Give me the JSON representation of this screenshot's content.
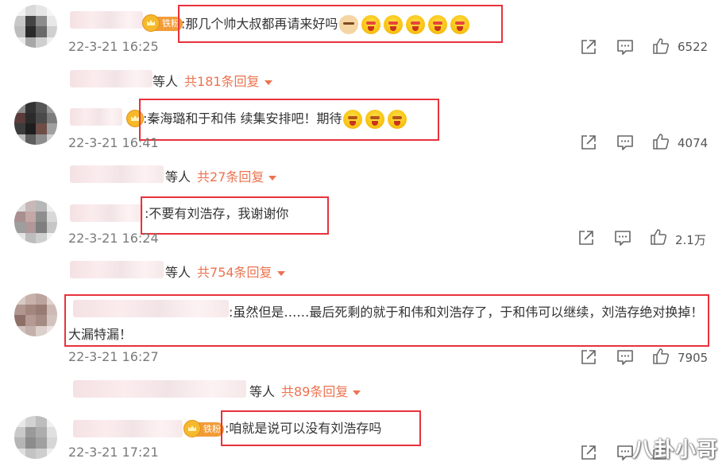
{
  "colors": {
    "accent_orange": "#eb7350",
    "highlight_red": "#e8323c",
    "badge_orange": "#f29c38",
    "timestamp_gray": "#7a7a7a"
  },
  "icons": {
    "share": "share-icon",
    "comment": "comment-icon",
    "like": "thumbs-up-icon",
    "dropdown": "chevron-down-icon",
    "badge": "crown-icon",
    "emoji_face": "grinning-face-icon",
    "emoji_cat": "cat-face-icon"
  },
  "comments": [
    {
      "badge": "铁粉",
      "text": ":那几个帅大叔都再请来好吗",
      "time": "22-3-21 16:25",
      "likes": "6522",
      "reply_who": "等人",
      "reply_link": "共181条回复"
    },
    {
      "badge": "",
      "text": ":秦海璐和于和伟 续集安排吧！期待",
      "time": "22-3-21 16:41",
      "likes": "4074",
      "reply_who": "等人",
      "reply_link": "共27条回复"
    },
    {
      "badge": "",
      "text": ":不要有刘浩存，我谢谢你",
      "time": "22-3-21 16:24",
      "likes": "2.1万",
      "reply_who": "等人",
      "reply_link": "共754条回复"
    },
    {
      "badge": "",
      "text": ":虽然但是……最后死剩的就于和伟和刘浩存了，于和伟可以继续，刘浩存绝对换掉！大漏特漏！",
      "time": "22-3-21 16:27",
      "likes": "7905",
      "reply_who": "等人",
      "reply_link": "共89条回复"
    },
    {
      "badge": "铁粉",
      "text": ":咱就是说可以没有刘浩存吗",
      "time": "22-3-21 17:21",
      "likes": ""
    }
  ],
  "watermark": "八卦小哥"
}
